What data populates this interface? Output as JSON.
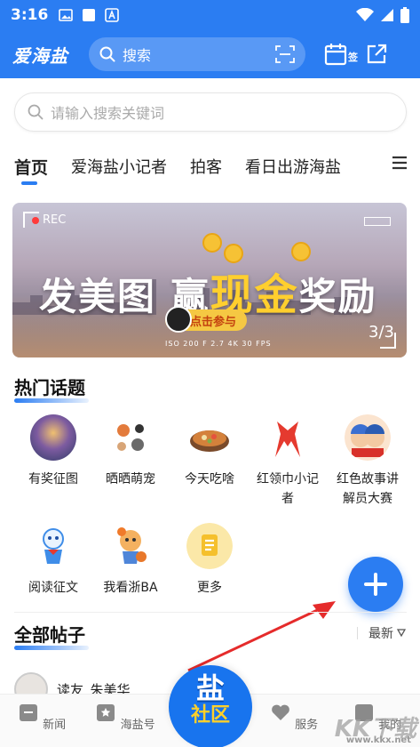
{
  "status_bar": {
    "time": "3:16"
  },
  "header": {
    "logo": "爱海盐",
    "search_placeholder": "搜索",
    "calendar_label": "签"
  },
  "search": {
    "placeholder": "请输入搜索关键词"
  },
  "tabs": [
    {
      "label": "首页",
      "active": true
    },
    {
      "label": "爱海盐小记者",
      "active": false
    },
    {
      "label": "拍客",
      "active": false
    },
    {
      "label": "看日出游海盐",
      "active": false
    }
  ],
  "banner": {
    "rec": "REC",
    "title_a": "发美图 赢",
    "title_b": "现金",
    "title_c": "奖励",
    "cta": "点击参与",
    "meta": "ISO 200   F 2.7   4K   30 FPS",
    "page": "3/3"
  },
  "hot_topics": {
    "heading": "热门话题",
    "items": [
      {
        "label": "有奖征图"
      },
      {
        "label": "晒晒萌宠"
      },
      {
        "label": "今天吃啥"
      },
      {
        "label": "红领巾小记者"
      },
      {
        "label": "红色故事讲解员大赛"
      },
      {
        "label": "阅读征文"
      },
      {
        "label": "我看浙BA"
      },
      {
        "label": "更多"
      }
    ]
  },
  "all_posts": {
    "heading": "全部帖子",
    "sort": "最新",
    "first_post_user": "读友_朱美华"
  },
  "bottom_nav": {
    "items": [
      {
        "label": "新闻"
      },
      {
        "label": "海盐号"
      },
      {
        "label": "服务"
      },
      {
        "label": "我的"
      }
    ],
    "center_top": "盐",
    "center_bottom": "社区"
  },
  "watermark": {
    "text": "KK下载",
    "url": "www.kkx.net"
  },
  "colors": {
    "primary": "#2b7df2",
    "gold": "#ffcf2e"
  }
}
